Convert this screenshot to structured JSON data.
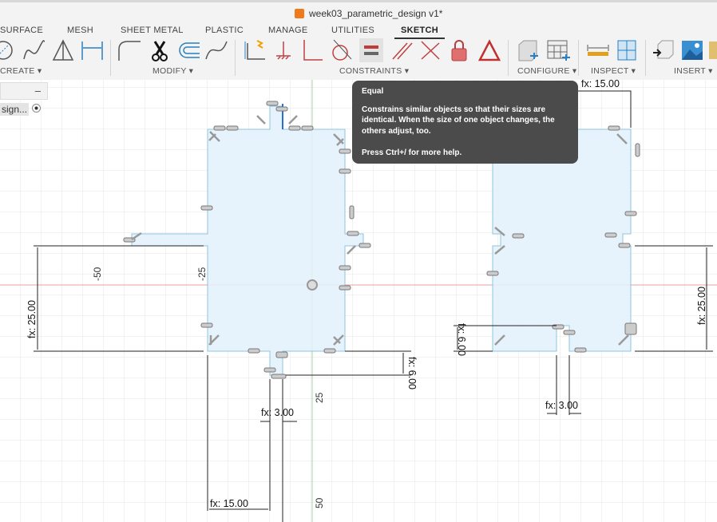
{
  "window": {
    "title": "week03_parametric_design v1*"
  },
  "tabs": [
    {
      "label": "SURFACE"
    },
    {
      "label": "MESH"
    },
    {
      "label": "SHEET METAL"
    },
    {
      "label": "PLASTIC"
    },
    {
      "label": "MANAGE"
    },
    {
      "label": "UTILITIES"
    },
    {
      "label": "SKETCH",
      "active": true
    }
  ],
  "groups": {
    "create": "CREATE ▾",
    "modify": "MODIFY ▾",
    "constraints": "CONSTRAINTS ▾",
    "configure": "CONFIGURE ▾",
    "inspect": "INSPECT ▾",
    "insert": "INSERT ▾"
  },
  "browser": {
    "collapse": "–",
    "item": "sign..."
  },
  "tooltip": {
    "title": "Equal",
    "body": "Constrains similar objects so that their sizes are identical. When the size of one object changes, the others adjust, too.",
    "help": "Press Ctrl+/ for more help."
  },
  "dimensions": {
    "left_height": "fx: 25.00",
    "left_notch": "fx: 6.00",
    "left_notch_width": "fx: 3.00",
    "left_width": "fx: 15.00",
    "right_width": "fx: 15.00",
    "right_height": "fx: 25.00",
    "right_notch": "fx: 6.00",
    "right_notch_width": "fx: 3.00"
  },
  "axis_labels": {
    "x_neg50": "-50",
    "x_neg25": "-25",
    "y_25": "25",
    "y_50": "50"
  },
  "colors": {
    "sketch_fill": "#e3f1fb",
    "sketch_line": "#8cc4de",
    "x_axis": "#e8a0a0",
    "y_axis": "#a8d4a8",
    "tooltip_bg": "#4b4b4b"
  }
}
